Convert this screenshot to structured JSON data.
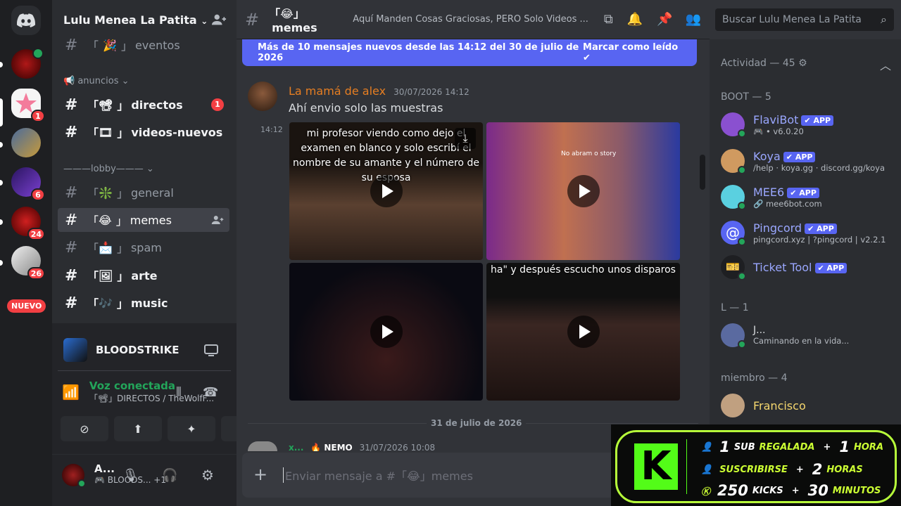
{
  "server": {
    "name": "Lulu Menea La Patita"
  },
  "guilds": {
    "badges": [
      "1",
      "6",
      "24",
      "26"
    ],
    "nuevo": "NUEVO"
  },
  "channels": {
    "eventos": {
      "emoji": "🎉",
      "name": "eventos"
    },
    "cat_anuncios": "anuncios",
    "directos": {
      "emoji": "📽",
      "name": "directos",
      "badge": "1"
    },
    "videos": {
      "emoji": "🎞",
      "name": "videos-nuevos"
    },
    "cat_lobby": "———lobby———",
    "general": {
      "emoji": "❇️",
      "name": "general"
    },
    "memes": {
      "emoji": "😂",
      "name": "memes"
    },
    "spam": {
      "emoji": "📩",
      "name": "spam"
    },
    "arte": {
      "emoji": "🖼",
      "name": "arte"
    },
    "music": {
      "emoji": "🎶",
      "name": "music"
    }
  },
  "activity": {
    "name": "BLOODSTRIKE"
  },
  "voice": {
    "status": "Voz conectada",
    "channel": "「📽」DIRECTOS / TheWolfF..."
  },
  "user": {
    "name": "A...",
    "status": "BLOODS...",
    "extra": "+1"
  },
  "topbar": {
    "bracket_open": "「",
    "emoji": "😂",
    "bracket_close": "」",
    "channel": "memes",
    "topic": "Aquí Manden Cosas Graciosas, PERO Solo Videos ...",
    "search_placeholder": "Buscar Lulu Menea La Patita"
  },
  "banner": {
    "text": "Más de 10 mensajes nuevos desde las 14:12 del 30 de julio de 2026",
    "action": "Marcar como leído"
  },
  "messages": {
    "m1": {
      "author": "La mamá de alex",
      "timestamp": "30/07/2026 14:12",
      "text": "Ahí envio solo las muestras",
      "time_side": "14:12"
    },
    "captions": {
      "v1": "mi profesor viendo como dejo el examen en blanco y solo escribí el nombre de su amante y el número de su esposa",
      "v2": "No abram o story",
      "v4": "ha\" y después escucho unos disparos"
    },
    "divider": "31 de julio de 2026",
    "m2": {
      "author": "x...",
      "tag": "NEMO",
      "timestamp": "31/07/2026 10:08"
    }
  },
  "composer": {
    "placeholder": "Enviar mensaje a #「😂」memes"
  },
  "members": {
    "header_activity": "Actividad — 45",
    "header_boot": "BOOT — 5",
    "bots": [
      {
        "name": "FlaviBot",
        "app": "APP",
        "sub": "v6.0.20",
        "color": "#5865f2"
      },
      {
        "name": "Koya",
        "app": "APP",
        "sub": "/help · koya.gg · discord.gg/koya",
        "color": "#5865f2"
      },
      {
        "name": "MEE6",
        "app": "APP",
        "sub": "🔗 mee6bot.com",
        "color": "#5865f2"
      },
      {
        "name": "Pingcord",
        "app": "APP",
        "sub": "pingcord.xyz | ?pingcord | v2.2.1",
        "color": "#5865f2"
      },
      {
        "name": "Ticket Tool",
        "app": "APP",
        "sub": "",
        "color": "#5865f2"
      }
    ],
    "header_l": "L — 1",
    "l_member": {
      "name": "J...",
      "sub": "Caminando en la vida..."
    },
    "header_miembro": "miembro — 4",
    "miembro": {
      "name": "Francisco"
    }
  },
  "promo": {
    "r1": {
      "num": "1",
      "a": "SUB",
      "b": "REGALADA",
      "plus": "+",
      "num2": "1",
      "c": "HORA"
    },
    "r2": {
      "a": "SUSCRIBIRSE",
      "plus": "+",
      "num2": "2",
      "c": "HORAS"
    },
    "r3": {
      "num": "250",
      "a": "KICKS",
      "plus": "+",
      "num2": "30",
      "c": "MINUTOS"
    },
    "logo": "K"
  }
}
